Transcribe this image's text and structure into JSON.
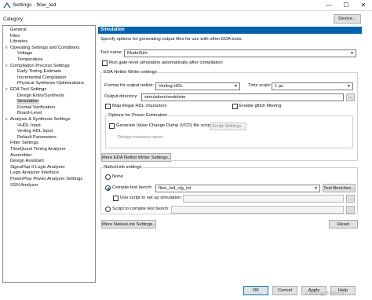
{
  "window": {
    "title": "Settings - flow_led",
    "minimize": "—",
    "maximize": "☐",
    "close": "✕"
  },
  "category_label": "Category:",
  "device_button": "Device...",
  "tree": [
    {
      "label": "General",
      "indent": 0,
      "toggle": ""
    },
    {
      "label": "Files",
      "indent": 0,
      "toggle": ""
    },
    {
      "label": "Libraries",
      "indent": 0,
      "toggle": ""
    },
    {
      "label": "Operating Settings and Conditions",
      "indent": 0,
      "toggle": "v"
    },
    {
      "label": "Voltage",
      "indent": 2,
      "toggle": ""
    },
    {
      "label": "Temperature",
      "indent": 2,
      "toggle": ""
    },
    {
      "label": "Compilation Process Settings",
      "indent": 0,
      "toggle": "v"
    },
    {
      "label": "Early Timing Estimate",
      "indent": 2,
      "toggle": ""
    },
    {
      "label": "Incremental Compilation",
      "indent": 2,
      "toggle": ""
    },
    {
      "label": "Physical Synthesis Optimizations",
      "indent": 2,
      "toggle": ""
    },
    {
      "label": "EDA Tool Settings",
      "indent": 0,
      "toggle": "v"
    },
    {
      "label": "Design Entry/Synthesis",
      "indent": 2,
      "toggle": ""
    },
    {
      "label": "Simulation",
      "indent": 2,
      "toggle": "",
      "selected": true
    },
    {
      "label": "Formal Verification",
      "indent": 2,
      "toggle": ""
    },
    {
      "label": "Board-Level",
      "indent": 2,
      "toggle": ""
    },
    {
      "label": "Analysis & Synthesis Settings",
      "indent": 0,
      "toggle": "v"
    },
    {
      "label": "VHDL Input",
      "indent": 2,
      "toggle": ""
    },
    {
      "label": "Verilog HDL Input",
      "indent": 2,
      "toggle": ""
    },
    {
      "label": "Default Parameters",
      "indent": 2,
      "toggle": ""
    },
    {
      "label": "Fitter Settings",
      "indent": 0,
      "toggle": ""
    },
    {
      "label": "TimeQuest Timing Analyzer",
      "indent": 0,
      "toggle": ""
    },
    {
      "label": "Assembler",
      "indent": 0,
      "toggle": ""
    },
    {
      "label": "Design Assistant",
      "indent": 0,
      "toggle": ""
    },
    {
      "label": "SignalTap II Logic Analyzer",
      "indent": 0,
      "toggle": ""
    },
    {
      "label": "Logic Analyzer Interface",
      "indent": 0,
      "toggle": ""
    },
    {
      "label": "PowerPlay Power Analyzer Settings",
      "indent": 0,
      "toggle": ""
    },
    {
      "label": "SSN Analyzer",
      "indent": 0,
      "toggle": ""
    }
  ],
  "panel": {
    "header": "Simulation",
    "description": "Specify options for generating output files for use with other EDA tools.",
    "tool_name_label": "Tool name:",
    "tool_name_value": "ModelSim",
    "run_gate_level": "Run gate-level simulation automatically after compilation",
    "netlist_group": "EDA Netlist Writer settings",
    "format_label": "Format for output netlist:",
    "format_value": "Verilog HDL",
    "time_scale_label": "Time scale:",
    "time_scale_value": "1 ps",
    "output_dir_label": "Output directory:",
    "output_dir_value": "simulation/modelsim",
    "browse_label": "...",
    "map_illegal": "Map illegal HDL characters",
    "enable_glitch": "Enable glitch filtering",
    "power_group": "Options for Power Estimation",
    "generate_vcd": "Generate Value Change Dump (VCD) file script",
    "script_settings_button": "Script Settings...",
    "design_instance_label": "Design instance name:",
    "more_netlist_button": "More EDA Netlist Writer Settings...",
    "nativelink_group": "NativeLink settings",
    "none_label": "None",
    "compile_tb_label": "Compile test bench:",
    "compile_tb_value": "flow_led_vlg_tst",
    "test_benches_button": "Test Benches...",
    "use_script_label": "Use script to set up simulation:",
    "script_compile_label": "Script to compile test bench:",
    "more_nativelink_button": "More NativeLink Settings...",
    "reset_button": "Reset"
  },
  "footer": {
    "ok": "OK",
    "cancel": "Cancel",
    "apply": "Apply",
    "help": "Help"
  },
  "watermark": "CSDN @齐名セ33"
}
